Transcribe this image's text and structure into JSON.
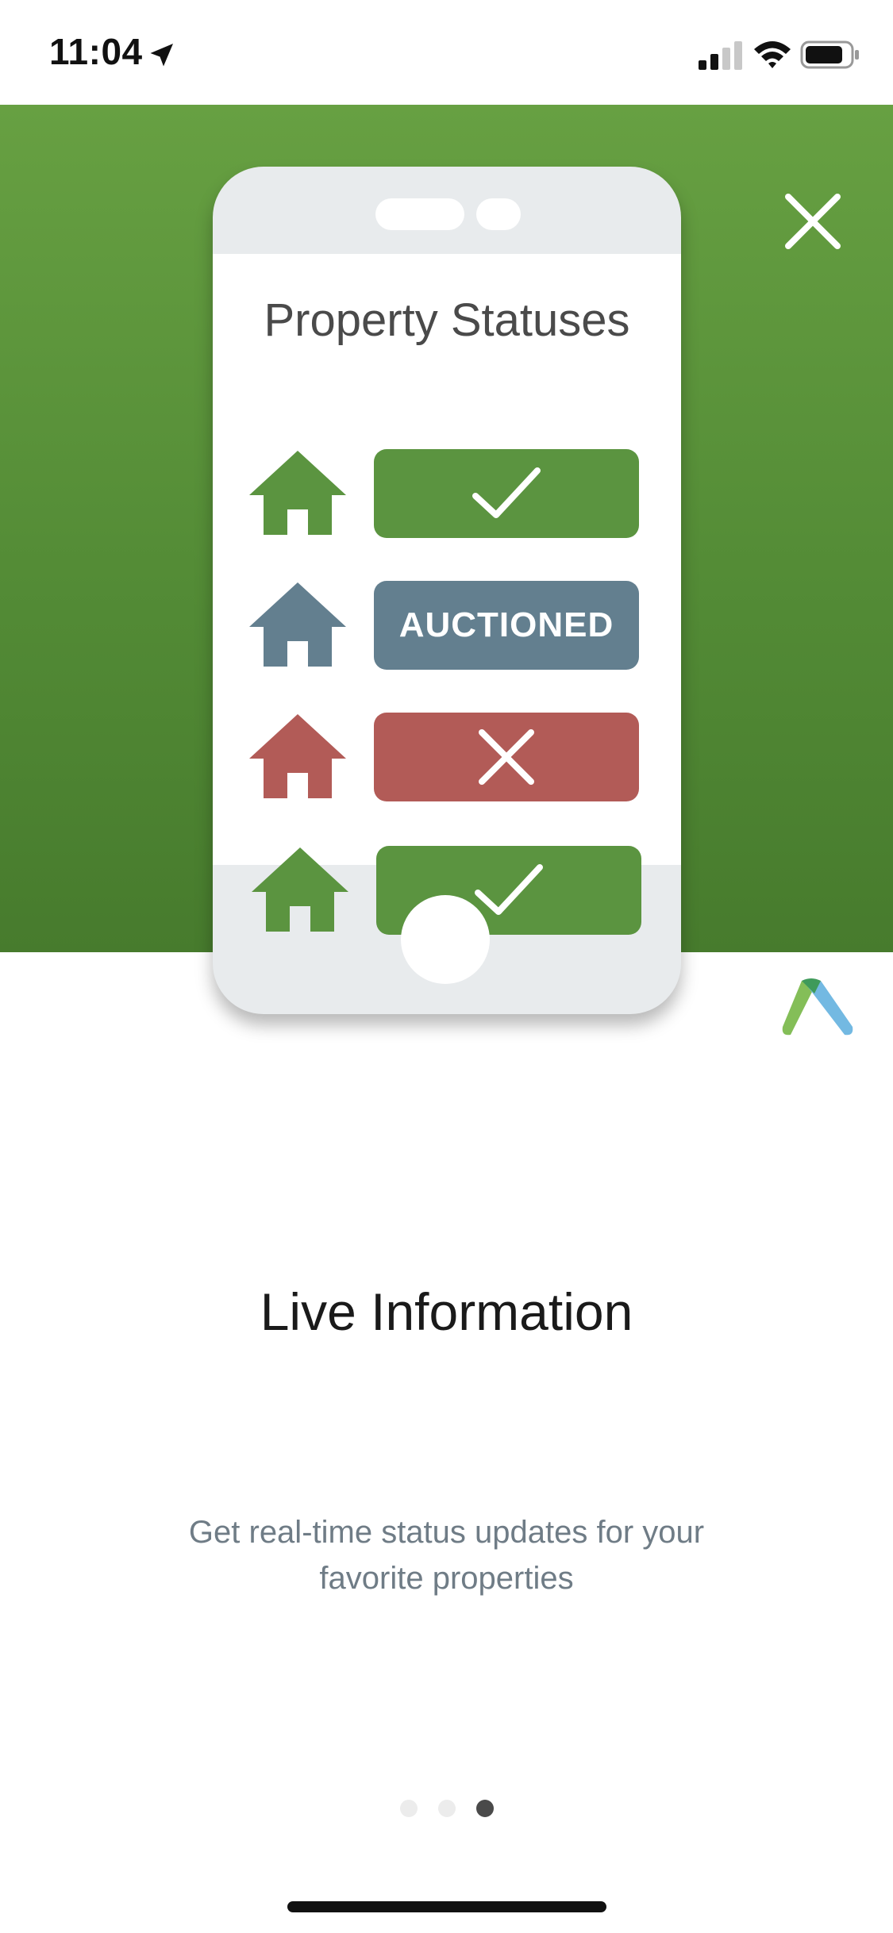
{
  "status_bar": {
    "time": "11:04"
  },
  "phone_card": {
    "title": "Property Statuses",
    "rows": [
      {
        "status": "check",
        "house_color": "#5b9440",
        "badge_color": "#5b9440"
      },
      {
        "status": "text",
        "label": "AUCTIONED",
        "house_color": "#637f8f",
        "badge_color": "#637f8f"
      },
      {
        "status": "x",
        "house_color": "#b25b57",
        "badge_color": "#b25b57"
      },
      {
        "status": "check",
        "house_color": "#5b9440",
        "badge_color": "#5b9440"
      }
    ]
  },
  "content": {
    "headline": "Live Information",
    "description": "Get real-time status updates for your favorite properties"
  },
  "pagination": {
    "total": 3,
    "active_index": 2
  },
  "colors": {
    "hero_top": "#67a042",
    "hero_bottom": "#477b2d",
    "logo_green": "#7dbb4f",
    "logo_blue": "#6cb5e0"
  },
  "icons": [
    "location-arrow-icon",
    "signal-icon",
    "wifi-icon",
    "battery-icon",
    "close-icon",
    "house-icon",
    "check-icon",
    "x-icon",
    "brand-logo"
  ]
}
